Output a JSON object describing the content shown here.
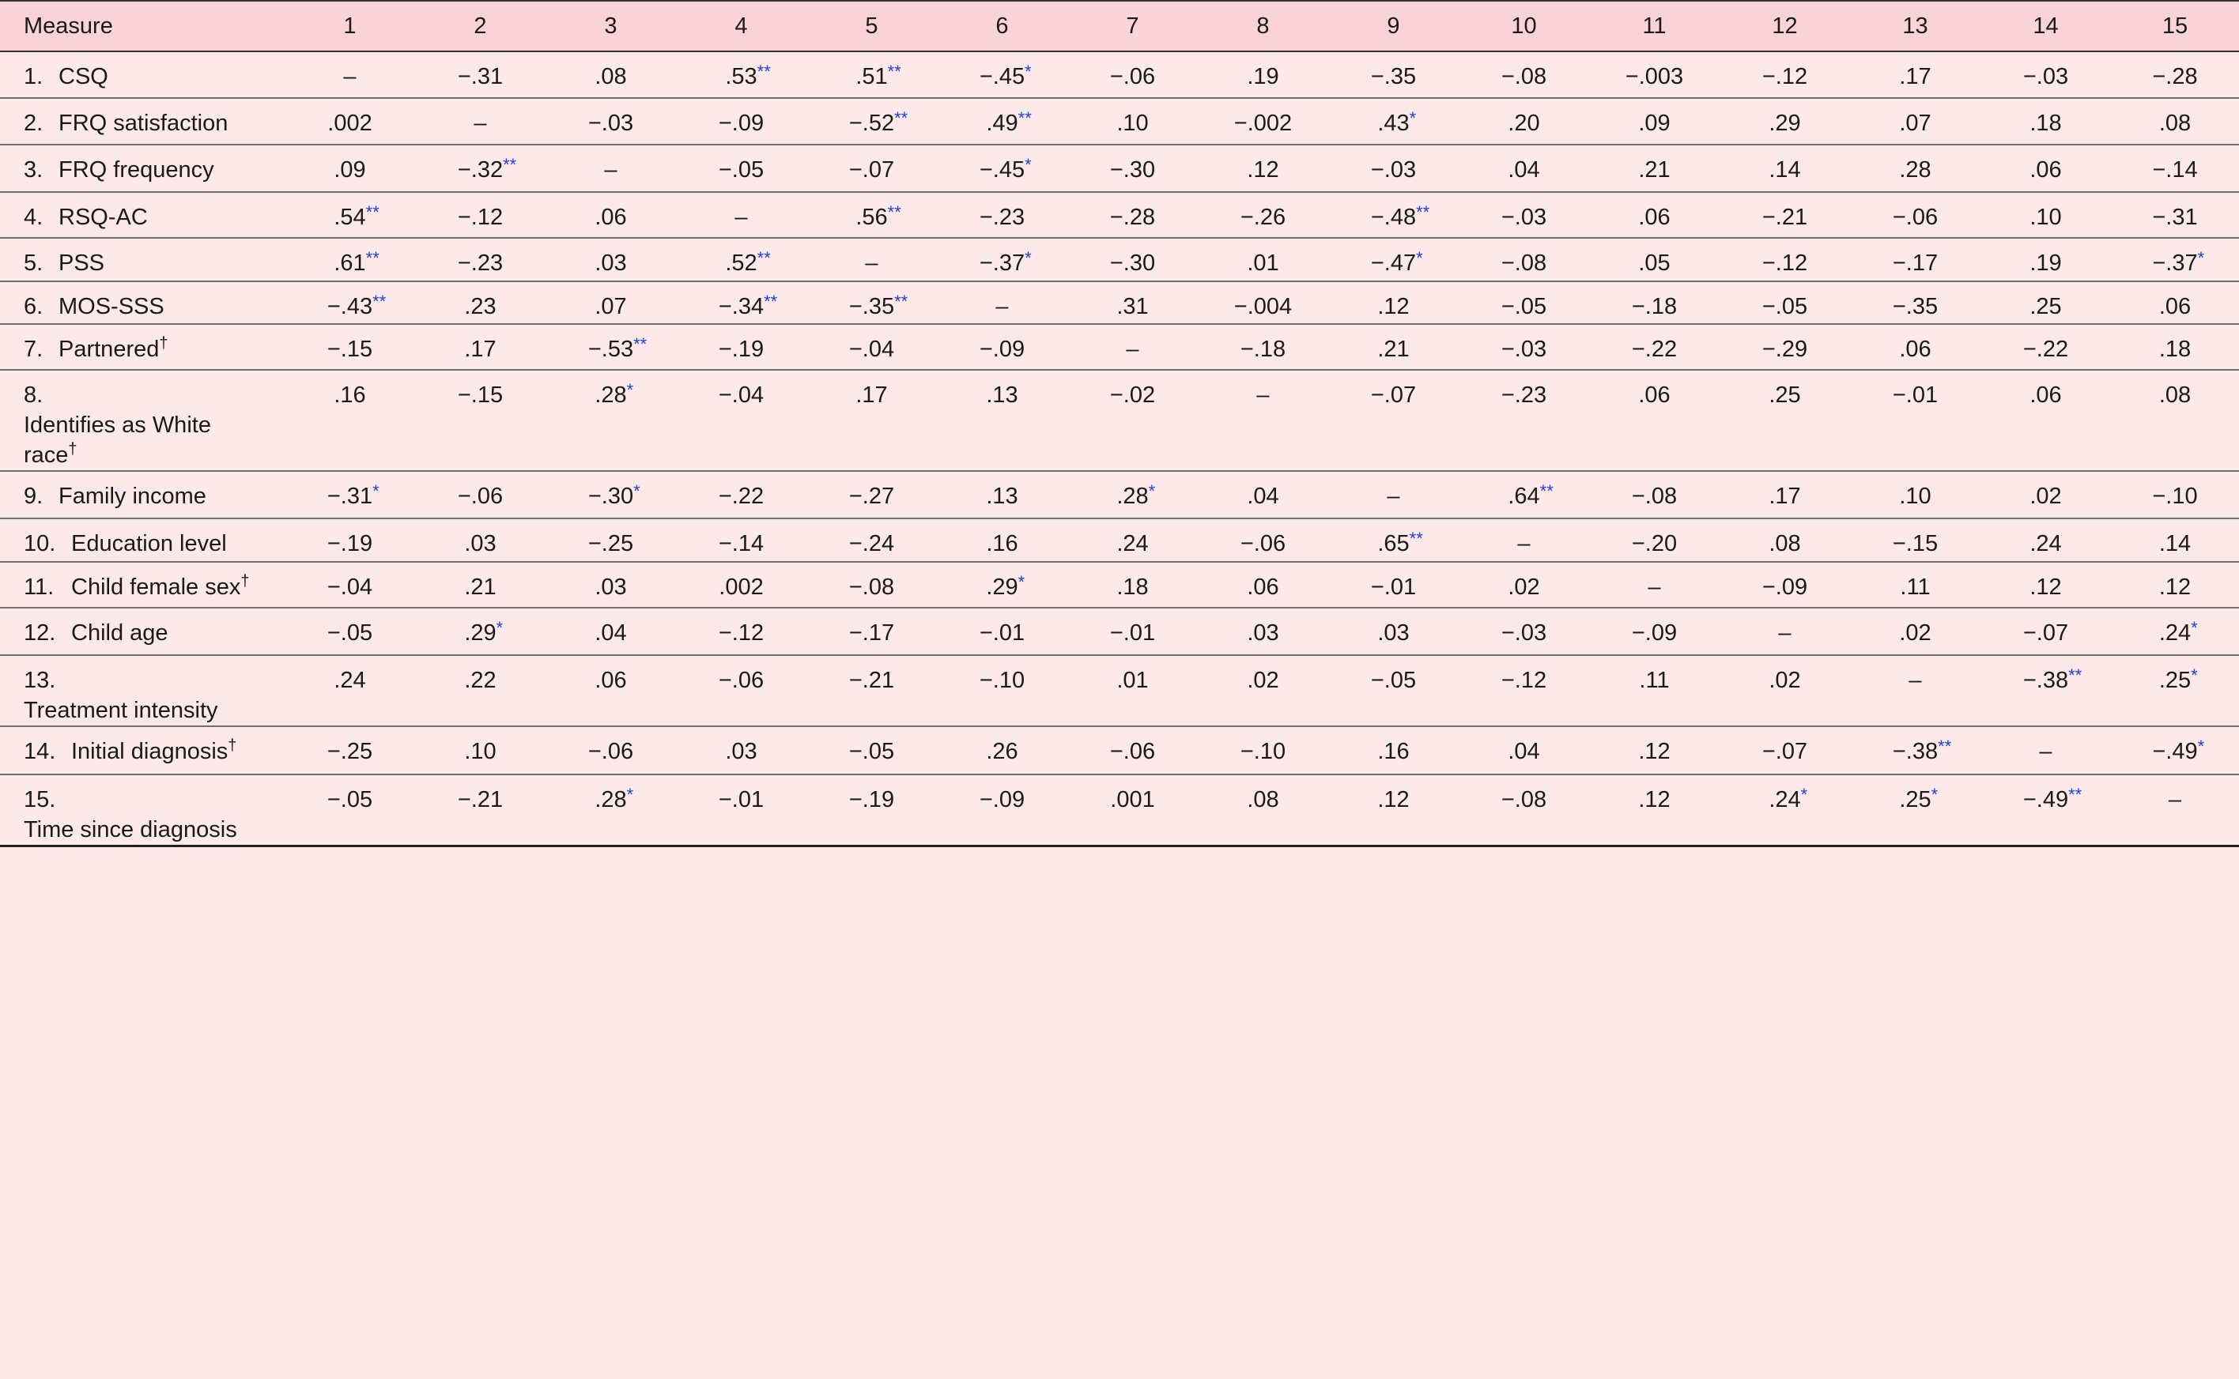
{
  "table": {
    "measure_header": "Measure",
    "columns": [
      "1",
      "2",
      "3",
      "4",
      "5",
      "6",
      "7",
      "8",
      "9",
      "10",
      "11",
      "12",
      "13",
      "14",
      "15"
    ],
    "rows": [
      {
        "num": "1.",
        "label": "CSQ",
        "dagger": "",
        "cells": [
          [
            "–",
            ""
          ],
          [
            "−.31",
            ""
          ],
          [
            ".08",
            ""
          ],
          [
            ".53",
            "**"
          ],
          [
            ".51",
            "**"
          ],
          [
            "−.45",
            "*"
          ],
          [
            "−.06",
            ""
          ],
          [
            ".19",
            ""
          ],
          [
            "−.35",
            ""
          ],
          [
            "−.08",
            ""
          ],
          [
            "−.003",
            ""
          ],
          [
            "−.12",
            ""
          ],
          [
            ".17",
            ""
          ],
          [
            "−.03",
            ""
          ],
          [
            "−.28",
            ""
          ]
        ]
      },
      {
        "num": "2.",
        "label": "FRQ satisfaction",
        "dagger": "",
        "cells": [
          [
            ".002",
            ""
          ],
          [
            "–",
            ""
          ],
          [
            "−.03",
            ""
          ],
          [
            "−.09",
            ""
          ],
          [
            "−.52",
            "**"
          ],
          [
            ".49",
            "**"
          ],
          [
            ".10",
            ""
          ],
          [
            "−.002",
            ""
          ],
          [
            ".43",
            "*"
          ],
          [
            ".20",
            ""
          ],
          [
            ".09",
            ""
          ],
          [
            ".29",
            ""
          ],
          [
            ".07",
            ""
          ],
          [
            ".18",
            ""
          ],
          [
            ".08",
            ""
          ]
        ]
      },
      {
        "num": "3.",
        "label": "FRQ frequency",
        "dagger": "",
        "cells": [
          [
            ".09",
            ""
          ],
          [
            "−.32",
            "**"
          ],
          [
            "–",
            ""
          ],
          [
            "−.05",
            ""
          ],
          [
            "−.07",
            ""
          ],
          [
            "−.45",
            "*"
          ],
          [
            "−.30",
            ""
          ],
          [
            ".12",
            ""
          ],
          [
            "−.03",
            ""
          ],
          [
            ".04",
            ""
          ],
          [
            ".21",
            ""
          ],
          [
            ".14",
            ""
          ],
          [
            ".28",
            ""
          ],
          [
            ".06",
            ""
          ],
          [
            "−.14",
            ""
          ]
        ]
      },
      {
        "num": "4.",
        "label": "RSQ-AC",
        "dagger": "",
        "cells": [
          [
            ".54",
            "**"
          ],
          [
            "−.12",
            ""
          ],
          [
            ".06",
            ""
          ],
          [
            "–",
            ""
          ],
          [
            ".56",
            "**"
          ],
          [
            "−.23",
            ""
          ],
          [
            "−.28",
            ""
          ],
          [
            "−.26",
            ""
          ],
          [
            "−.48",
            "**"
          ],
          [
            "−.03",
            ""
          ],
          [
            ".06",
            ""
          ],
          [
            "−.21",
            ""
          ],
          [
            "−.06",
            ""
          ],
          [
            ".10",
            ""
          ],
          [
            "−.31",
            ""
          ]
        ]
      },
      {
        "num": "5.",
        "label": "PSS",
        "dagger": "",
        "cells": [
          [
            ".61",
            "**"
          ],
          [
            "−.23",
            ""
          ],
          [
            ".03",
            ""
          ],
          [
            ".52",
            "**"
          ],
          [
            "–",
            ""
          ],
          [
            "−.37",
            "*"
          ],
          [
            "−.30",
            ""
          ],
          [
            ".01",
            ""
          ],
          [
            "−.47",
            "*"
          ],
          [
            "−.08",
            ""
          ],
          [
            ".05",
            ""
          ],
          [
            "−.12",
            ""
          ],
          [
            "−.17",
            ""
          ],
          [
            ".19",
            ""
          ],
          [
            "−.37",
            "*"
          ]
        ]
      },
      {
        "num": "6.",
        "label": "MOS-SSS",
        "dagger": "",
        "cells": [
          [
            "−.43",
            "**"
          ],
          [
            ".23",
            ""
          ],
          [
            ".07",
            ""
          ],
          [
            "−.34",
            "**"
          ],
          [
            "−.35",
            "**"
          ],
          [
            "–",
            ""
          ],
          [
            ".31",
            ""
          ],
          [
            "−.004",
            ""
          ],
          [
            ".12",
            ""
          ],
          [
            "−.05",
            ""
          ],
          [
            "−.18",
            ""
          ],
          [
            "−.05",
            ""
          ],
          [
            "−.35",
            ""
          ],
          [
            ".25",
            ""
          ],
          [
            ".06",
            ""
          ]
        ]
      },
      {
        "num": "7.",
        "label": "Partnered",
        "dagger": "†",
        "cells": [
          [
            "−.15",
            ""
          ],
          [
            ".17",
            ""
          ],
          [
            "−.53",
            "**"
          ],
          [
            "−.19",
            ""
          ],
          [
            "−.04",
            ""
          ],
          [
            "−.09",
            ""
          ],
          [
            "–",
            ""
          ],
          [
            "−.18",
            ""
          ],
          [
            ".21",
            ""
          ],
          [
            "−.03",
            ""
          ],
          [
            "−.22",
            ""
          ],
          [
            "−.29",
            ""
          ],
          [
            ".06",
            ""
          ],
          [
            "−.22",
            ""
          ],
          [
            ".18",
            ""
          ]
        ]
      },
      {
        "num": "8.",
        "label": "Identifies as White race",
        "dagger": "†",
        "cells": [
          [
            ".16",
            ""
          ],
          [
            "−.15",
            ""
          ],
          [
            ".28",
            "*"
          ],
          [
            "−.04",
            ""
          ],
          [
            ".17",
            ""
          ],
          [
            ".13",
            ""
          ],
          [
            "−.02",
            ""
          ],
          [
            "–",
            ""
          ],
          [
            "−.07",
            ""
          ],
          [
            "−.23",
            ""
          ],
          [
            ".06",
            ""
          ],
          [
            ".25",
            ""
          ],
          [
            "−.01",
            ""
          ],
          [
            ".06",
            ""
          ],
          [
            ".08",
            ""
          ]
        ]
      },
      {
        "num": "9.",
        "label": "Family income",
        "dagger": "",
        "cells": [
          [
            "−.31",
            "*"
          ],
          [
            "−.06",
            ""
          ],
          [
            "−.30",
            "*"
          ],
          [
            "−.22",
            ""
          ],
          [
            "−.27",
            ""
          ],
          [
            ".13",
            ""
          ],
          [
            ".28",
            "*"
          ],
          [
            ".04",
            ""
          ],
          [
            "–",
            ""
          ],
          [
            ".64",
            "**"
          ],
          [
            "−.08",
            ""
          ],
          [
            ".17",
            ""
          ],
          [
            ".10",
            ""
          ],
          [
            ".02",
            ""
          ],
          [
            "−.10",
            ""
          ]
        ]
      },
      {
        "num": "10.",
        "label": "Education level",
        "dagger": "",
        "cells": [
          [
            "−.19",
            ""
          ],
          [
            ".03",
            ""
          ],
          [
            "−.25",
            ""
          ],
          [
            "−.14",
            ""
          ],
          [
            "−.24",
            ""
          ],
          [
            ".16",
            ""
          ],
          [
            ".24",
            ""
          ],
          [
            "−.06",
            ""
          ],
          [
            ".65",
            "**"
          ],
          [
            "–",
            ""
          ],
          [
            "−.20",
            ""
          ],
          [
            ".08",
            ""
          ],
          [
            "−.15",
            ""
          ],
          [
            ".24",
            ""
          ],
          [
            ".14",
            ""
          ]
        ]
      },
      {
        "num": "11.",
        "label": "Child female sex",
        "dagger": "†",
        "cells": [
          [
            "−.04",
            ""
          ],
          [
            ".21",
            ""
          ],
          [
            ".03",
            ""
          ],
          [
            ".002",
            ""
          ],
          [
            "−.08",
            ""
          ],
          [
            ".29",
            "*"
          ],
          [
            ".18",
            ""
          ],
          [
            ".06",
            ""
          ],
          [
            "−.01",
            ""
          ],
          [
            ".02",
            ""
          ],
          [
            "–",
            ""
          ],
          [
            "−.09",
            ""
          ],
          [
            ".11",
            ""
          ],
          [
            ".12",
            ""
          ],
          [
            ".12",
            ""
          ]
        ]
      },
      {
        "num": "12.",
        "label": "Child age",
        "dagger": "",
        "cells": [
          [
            "−.05",
            ""
          ],
          [
            ".29",
            "*"
          ],
          [
            ".04",
            ""
          ],
          [
            "−.12",
            ""
          ],
          [
            "−.17",
            ""
          ],
          [
            "−.01",
            ""
          ],
          [
            "−.01",
            ""
          ],
          [
            ".03",
            ""
          ],
          [
            ".03",
            ""
          ],
          [
            "−.03",
            ""
          ],
          [
            "−.09",
            ""
          ],
          [
            "–",
            ""
          ],
          [
            ".02",
            ""
          ],
          [
            "−.07",
            ""
          ],
          [
            ".24",
            "*"
          ]
        ]
      },
      {
        "num": "13.",
        "label": "Treatment intensity",
        "dagger": "",
        "cells": [
          [
            ".24",
            ""
          ],
          [
            ".22",
            ""
          ],
          [
            ".06",
            ""
          ],
          [
            "−.06",
            ""
          ],
          [
            "−.21",
            ""
          ],
          [
            "−.10",
            ""
          ],
          [
            ".01",
            ""
          ],
          [
            ".02",
            ""
          ],
          [
            "−.05",
            ""
          ],
          [
            "−.12",
            ""
          ],
          [
            ".11",
            ""
          ],
          [
            ".02",
            ""
          ],
          [
            "–",
            ""
          ],
          [
            "−.38",
            "**"
          ],
          [
            ".25",
            "*"
          ]
        ]
      },
      {
        "num": "14.",
        "label": "Initial diagnosis",
        "dagger": "†",
        "cells": [
          [
            "−.25",
            ""
          ],
          [
            ".10",
            ""
          ],
          [
            "−.06",
            ""
          ],
          [
            ".03",
            ""
          ],
          [
            "−.05",
            ""
          ],
          [
            ".26",
            ""
          ],
          [
            "−.06",
            ""
          ],
          [
            "−.10",
            ""
          ],
          [
            ".16",
            ""
          ],
          [
            ".04",
            ""
          ],
          [
            ".12",
            ""
          ],
          [
            "−.07",
            ""
          ],
          [
            "−.38",
            "**"
          ],
          [
            "–",
            ""
          ],
          [
            "−.49",
            "*"
          ]
        ]
      },
      {
        "num": "15.",
        "label": "Time since diagnosis",
        "dagger": "",
        "cells": [
          [
            "−.05",
            ""
          ],
          [
            "−.21",
            ""
          ],
          [
            ".28",
            "*"
          ],
          [
            "−.01",
            ""
          ],
          [
            "−.19",
            ""
          ],
          [
            "−.09",
            ""
          ],
          [
            ".001",
            ""
          ],
          [
            ".08",
            ""
          ],
          [
            ".12",
            ""
          ],
          [
            "−.08",
            ""
          ],
          [
            ".12",
            ""
          ],
          [
            ".24",
            "*"
          ],
          [
            ".25",
            "*"
          ],
          [
            "−.49",
            "**"
          ],
          [
            "–",
            ""
          ]
        ]
      }
    ]
  }
}
